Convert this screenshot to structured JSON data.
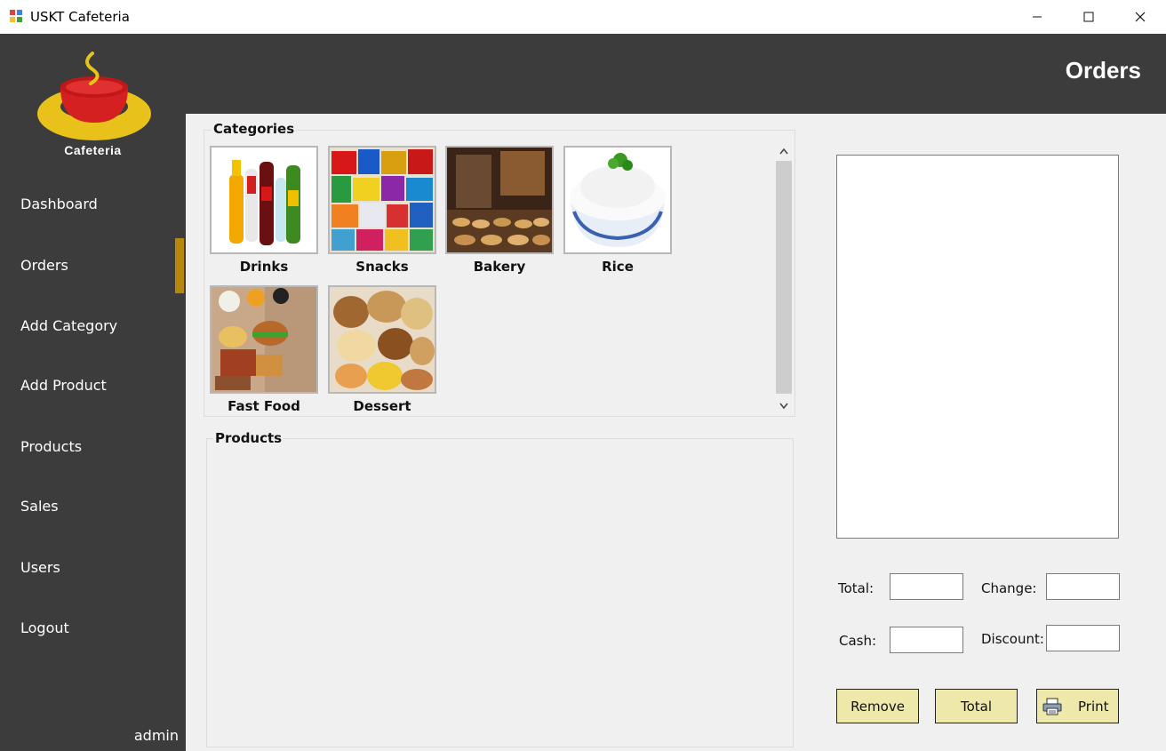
{
  "window": {
    "title": "USKT Cafeteria"
  },
  "header": {
    "title": "Orders"
  },
  "logo": {
    "text": "Cafeteria"
  },
  "sidebar": {
    "items": [
      {
        "label": "Dashboard"
      },
      {
        "label": "Orders"
      },
      {
        "label": "Add Category"
      },
      {
        "label": "Add Product"
      },
      {
        "label": "Products"
      },
      {
        "label": "Sales"
      },
      {
        "label": "Users"
      },
      {
        "label": "Logout"
      }
    ],
    "active": "Orders",
    "accent_color": "#b8860b",
    "user": "admin"
  },
  "categories": {
    "title": "Categories",
    "items": [
      {
        "label": "Drinks"
      },
      {
        "label": "Snacks"
      },
      {
        "label": "Bakery"
      },
      {
        "label": "Rice"
      },
      {
        "label": "Fast Food"
      },
      {
        "label": "Dessert"
      }
    ]
  },
  "products": {
    "title": "Products"
  },
  "order": {
    "total_label": "Total:",
    "change_label": "Change:",
    "cash_label": "Cash:",
    "discount_label": "Discount:",
    "total_value": "",
    "change_value": "",
    "cash_value": "",
    "discount_value": ""
  },
  "buttons": {
    "remove": "Remove",
    "total": "Total",
    "print": "Print",
    "color": "#eee8aa"
  }
}
